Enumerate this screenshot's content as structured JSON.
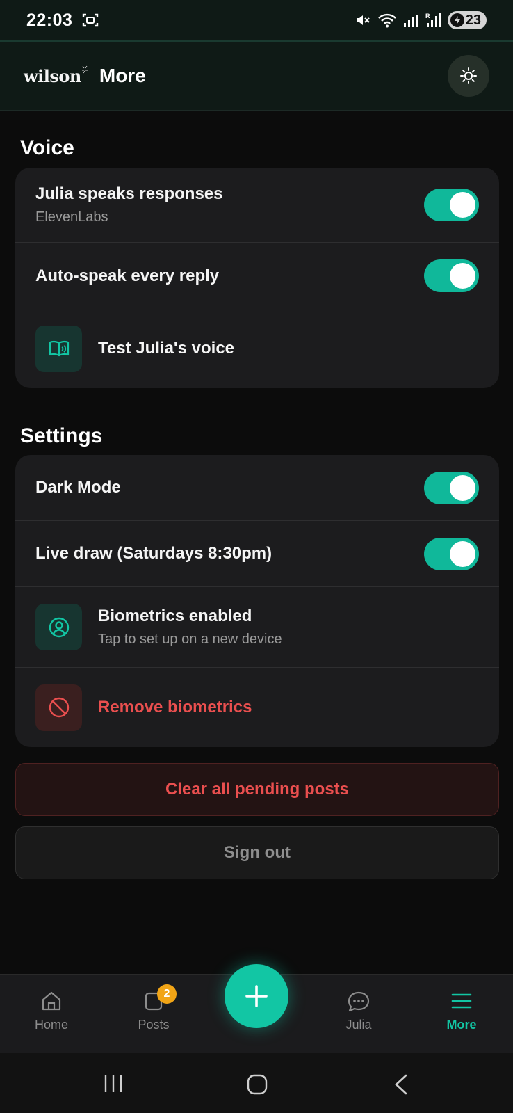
{
  "status_bar": {
    "time": "22:03",
    "battery": "23"
  },
  "header": {
    "logo": "wilson",
    "title": "More"
  },
  "voice": {
    "section_title": "Voice",
    "julia_speaks": {
      "label": "Julia speaks responses",
      "subtitle": "ElevenLabs",
      "enabled": true
    },
    "auto_speak": {
      "label": "Auto-speak every reply",
      "enabled": true
    },
    "test_voice": {
      "label": "Test Julia's voice",
      "icon": "book-icon"
    }
  },
  "settings": {
    "section_title": "Settings",
    "dark_mode": {
      "label": "Dark Mode",
      "enabled": true
    },
    "live_draw": {
      "label": "Live draw (Saturdays 8:30pm)",
      "enabled": true
    },
    "biometrics": {
      "label": "Biometrics enabled",
      "subtitle": "Tap to set up on a new device",
      "icon": "user-circle-icon"
    },
    "remove_biometrics": {
      "label": "Remove biometrics",
      "icon": "ban-icon"
    }
  },
  "actions": {
    "clear_pending": "Clear all pending posts",
    "sign_out": "Sign out"
  },
  "bottom_nav": {
    "home": "Home",
    "posts": "Posts",
    "posts_badge": "2",
    "julia": "Julia",
    "more": "More",
    "active": "More"
  },
  "colors": {
    "accent": "#12c6a4",
    "danger": "#ea4f4f",
    "badge": "#f2a516",
    "card": "#1c1c1e",
    "background": "#0c0c0c"
  }
}
